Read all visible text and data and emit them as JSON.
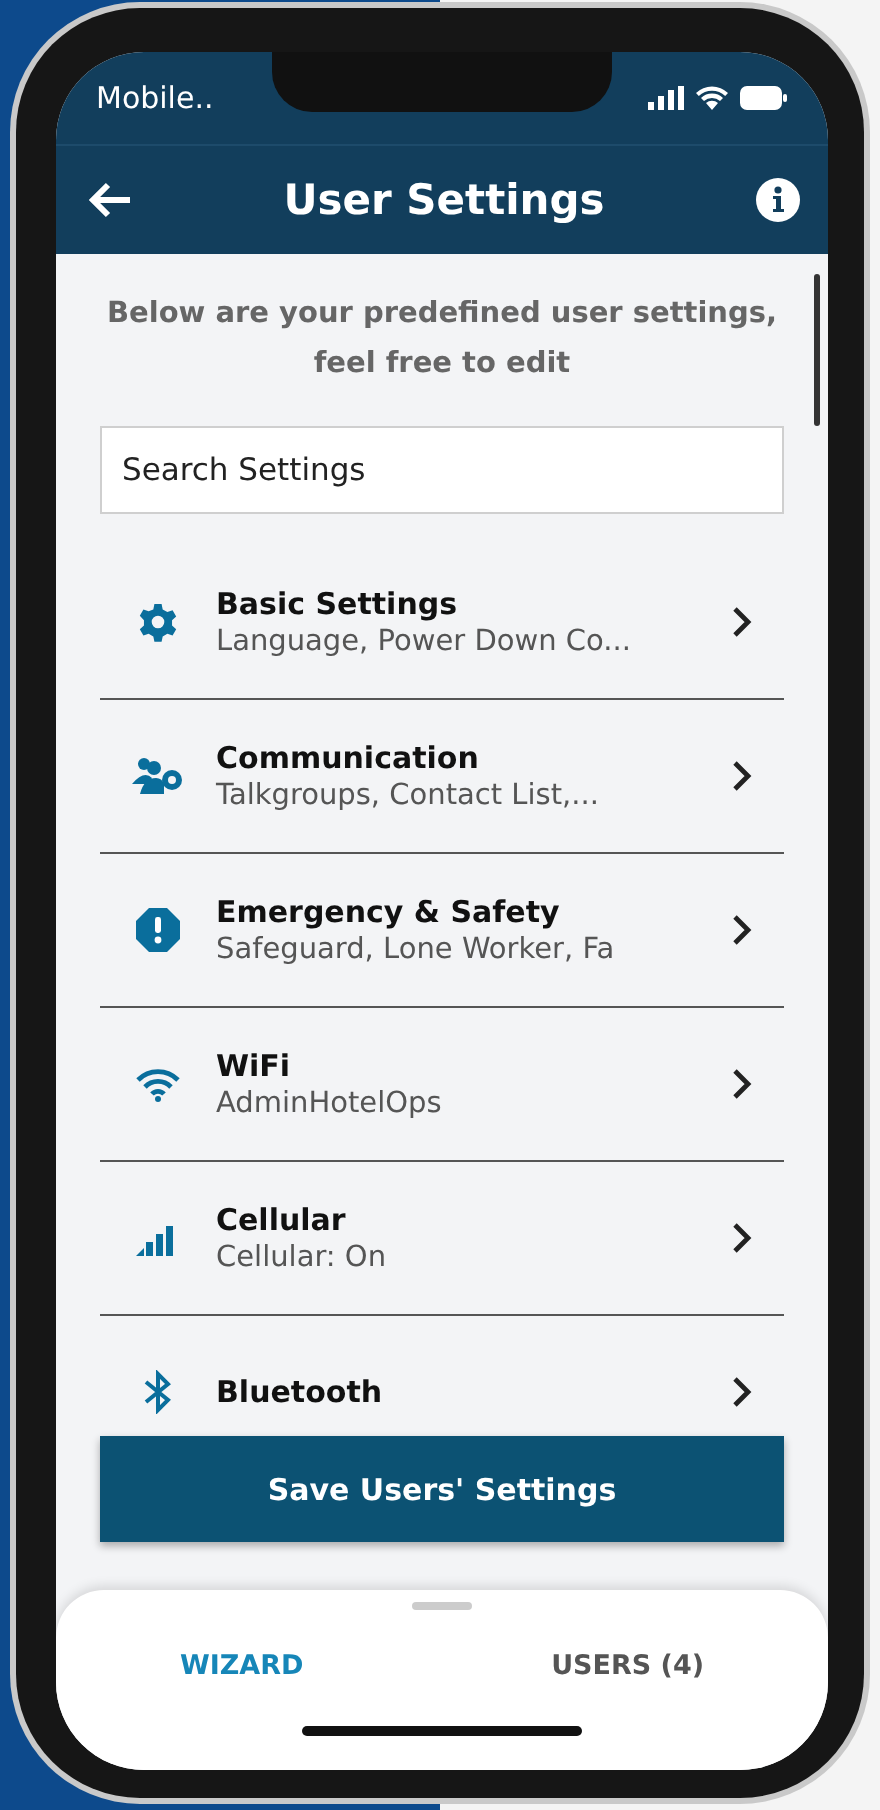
{
  "status_bar": {
    "carrier": "Mobile.."
  },
  "header": {
    "title": "User Settings"
  },
  "intro": "Below are your predefined user settings, feel free to edit",
  "search": {
    "placeholder": "Search Settings"
  },
  "settings": [
    {
      "title": "Basic Settings",
      "subtitle": "Language, Power Down Co..."
    },
    {
      "title": "Communication",
      "subtitle": "Talkgroups, Contact List,..."
    },
    {
      "title": "Emergency & Safety",
      "subtitle": "Safeguard, Lone Worker, Fa"
    },
    {
      "title": "WiFi",
      "subtitle": "AdminHotelOps"
    },
    {
      "title": "Cellular",
      "subtitle": "Cellular: On"
    },
    {
      "title": "Bluetooth"
    }
  ],
  "save_button": "Save Users' Settings",
  "bottom_tabs": [
    {
      "label": "WIZARD",
      "selected": true
    },
    {
      "label": "USERS (4)",
      "selected": false
    }
  ]
}
